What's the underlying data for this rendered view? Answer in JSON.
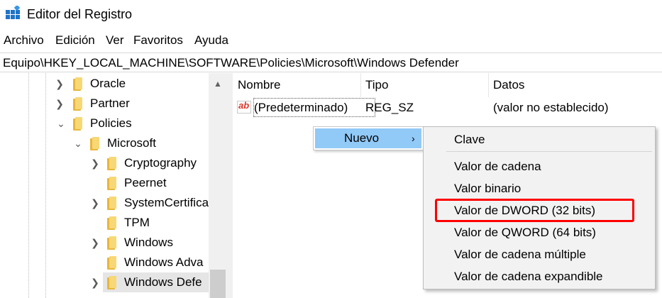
{
  "window": {
    "title": "Editor del Registro",
    "app_icon": "registry-editor-icon"
  },
  "menubar": {
    "items": [
      "Archivo",
      "Edición",
      "Ver",
      "Favoritos",
      "Ayuda"
    ]
  },
  "address": {
    "path": "Equipo\\HKEY_LOCAL_MACHINE\\SOFTWARE\\Policies\\Microsoft\\Windows Defender"
  },
  "tree": {
    "items": [
      {
        "label": "Oracle",
        "expander": "collapsed"
      },
      {
        "label": "Partner",
        "expander": "collapsed"
      },
      {
        "label": "Policies",
        "expander": "expanded"
      },
      {
        "label": "Microsoft",
        "expander": "expanded"
      },
      {
        "label": "Cryptography",
        "expander": "collapsed"
      },
      {
        "label": "Peernet",
        "expander": "none"
      },
      {
        "label": "SystemCertifica",
        "expander": "collapsed"
      },
      {
        "label": "TPM",
        "expander": "none"
      },
      {
        "label": "Windows",
        "expander": "collapsed"
      },
      {
        "label": "Windows Adva",
        "expander": "none"
      },
      {
        "label": "Windows Defe",
        "expander": "collapsed",
        "selected": true
      }
    ]
  },
  "list": {
    "columns": [
      "Nombre",
      "Tipo",
      "Datos"
    ],
    "rows": [
      {
        "icon": "string-value-icon",
        "name": "(Predeterminado)",
        "type": "REG_SZ",
        "data": "(valor no establecido)"
      }
    ]
  },
  "context_menu": {
    "parent_item": "Nuevo",
    "submenu_items": [
      "Clave",
      "Valor de cadena",
      "Valor binario",
      "Valor de DWORD (32 bits)",
      "Valor de QWORD (64 bits)",
      "Valor de cadena múltiple",
      "Valor de cadena expandible"
    ],
    "highlighted_item": "Valor de DWORD (32 bits)",
    "highlight_color": "#ff0000",
    "hover_color": "#91c9f7"
  }
}
